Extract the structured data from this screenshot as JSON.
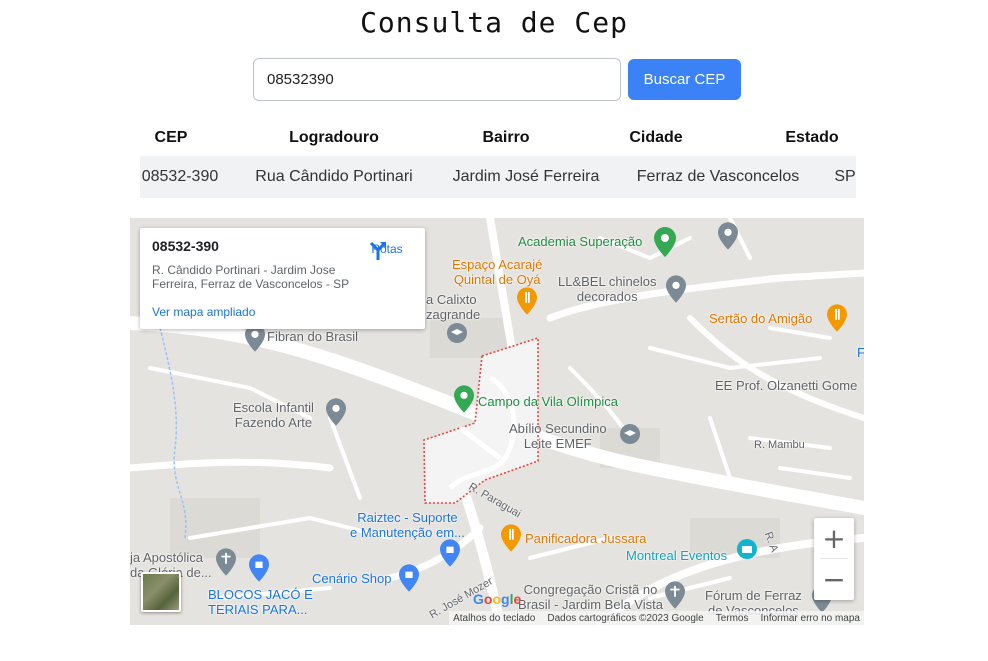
{
  "page": {
    "title": "Consulta de Cep"
  },
  "search": {
    "value": "08532390",
    "button_label": "Buscar CEP"
  },
  "table": {
    "headers": [
      "CEP",
      "Logradouro",
      "Bairro",
      "Cidade",
      "Estado"
    ],
    "rows": [
      [
        "08532-390",
        "Rua Cândido Portinari",
        "Jardim José Ferreira",
        "Ferraz de Vasconcelos",
        "SP"
      ]
    ]
  },
  "map": {
    "info_card": {
      "title": "08532-390",
      "address": "R. Cândido Portinari - Jardim Jose Ferreira, Ferraz de Vasconcelos - SP",
      "link": "Ver mapa ampliado",
      "directions_label": "Rotas",
      "directions_icon": "directions-icon"
    },
    "labels": {
      "academia": "Academia Superação",
      "espaco_line1": "Espaço Acarajé",
      "espaco_line2": "Quintal de Oyá",
      "llbel_line1": "LL&BEL chinelos",
      "llbel_line2": "decorados",
      "sertao": "Sertão do Amigão",
      "calixto_line1": "a Calixto",
      "calixto_line2": "zagrande",
      "fibran": "Fibran do Brasil",
      "campo": "Campo da Vila Olímpica",
      "olzanetti": "EE Prof. Olzanetti Gome",
      "escola_line1": "Escola Infantil",
      "escola_line2": "Fazendo Arte",
      "abilio_line1": "Abílio Secundino",
      "abilio_line2": "Leite EMEF",
      "mambu": "R. Mambu",
      "paraguai": "R. Paraguai",
      "raiztec_line1": "Raiztec - Suporte",
      "raiztec_line2": "e Manutenção em...",
      "panificadora": "Panificadora Jussara",
      "apostolica_line1": "ja Apostólica",
      "apostolica_line2": "da Glória de...",
      "montreal": "Montreal Eventos",
      "blocos_line1": "BLOCOS JACÓ E",
      "blocos_line2": "TERIAIS PARA...",
      "cenario": "Cenário Shop",
      "jose_mozer": "R. José Mozer",
      "congregacao_line1": "Congregação Cristã no",
      "congregacao_line2": "Brasil - Jardim Bela Vista",
      "forum_line1": "Fórum de Ferraz",
      "forum_line2": "de Vasconcelos",
      "ra": "R. A",
      "f_edge": "F"
    },
    "zoom_in": "+",
    "zoom_out": "−",
    "google": "Google",
    "attribution": {
      "shortcuts": "Atalhos do teclado",
      "data": "Dados cartográficos ©2023 Google",
      "terms": "Termos",
      "report": "Informar erro no mapa"
    },
    "colors": {
      "road": "#ffffff",
      "background": "#e5e3df",
      "area_outline": "#e8453c",
      "green_pin": "#34a853",
      "orange_pin": "#f29900",
      "blue_pin": "#4285f4",
      "gray_pin": "#7b8a94",
      "teal_pin": "#12b5cb"
    }
  }
}
